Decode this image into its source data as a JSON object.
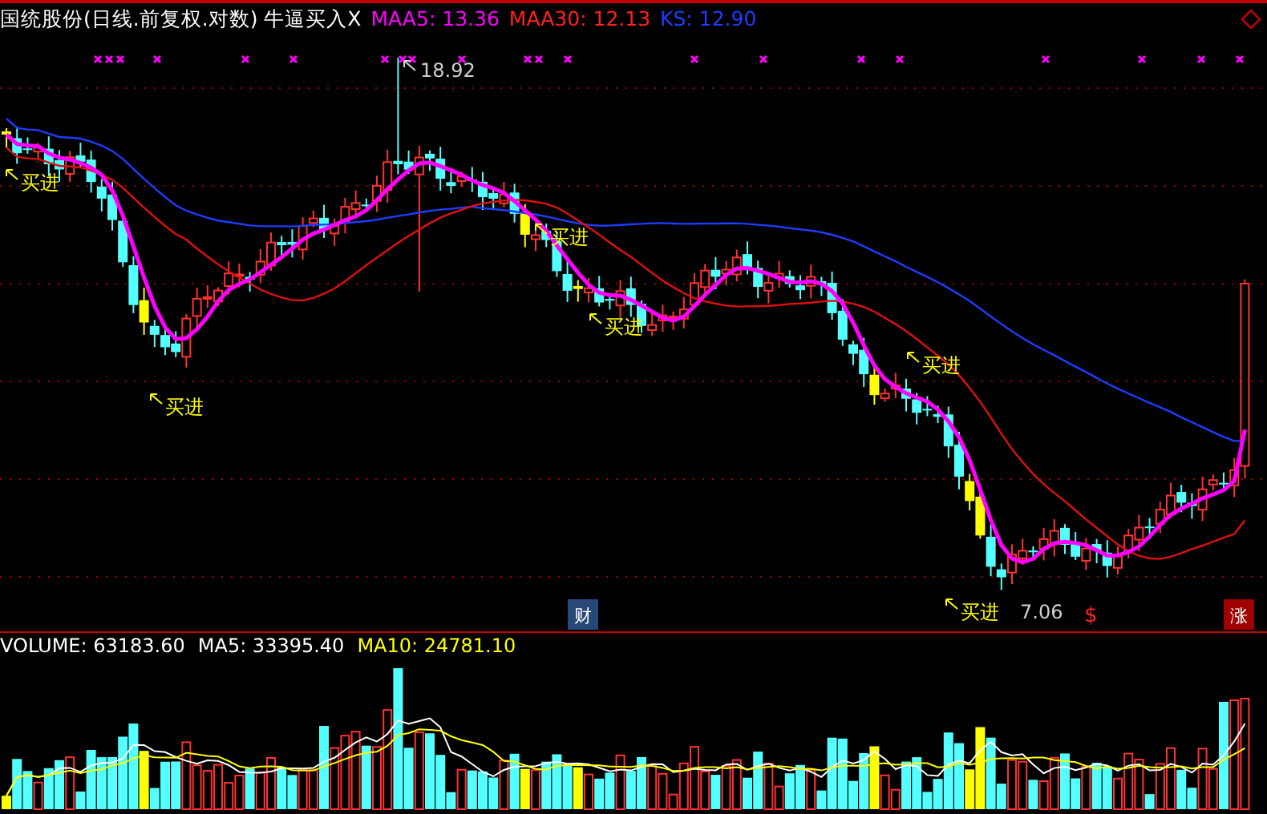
{
  "header": {
    "title": "国统股份(日线.前复权.对数) 牛逼买入X",
    "indicators": [
      {
        "label": "MAA5: 13.36",
        "color": "#ff00ff"
      },
      {
        "label": "MAA30: 12.13",
        "color": "#ff2020"
      },
      {
        "label": "KS: 12.90",
        "color": "#1e3cff"
      }
    ]
  },
  "price_labels": [
    {
      "kind": "high",
      "text": "18.92"
    },
    {
      "kind": "low",
      "text": "7.06"
    }
  ],
  "signals": [
    {
      "text": "买进"
    },
    {
      "text": "买进"
    },
    {
      "text": "买进"
    },
    {
      "text": "买进"
    },
    {
      "text": "买进"
    },
    {
      "text": "买进"
    }
  ],
  "event_markers": [
    {
      "kind": "finance",
      "text": "财"
    },
    {
      "kind": "dividend",
      "text": "$"
    },
    {
      "kind": "limit_up",
      "text": "涨"
    }
  ],
  "volume_legend": [
    {
      "label": "VOLUME: 63183.60",
      "color": "#ffffff"
    },
    {
      "label": "MA5: 33395.40",
      "color": "#ffffff"
    },
    {
      "label": "MA10: 24781.10",
      "color": "#ffff00"
    }
  ]
}
